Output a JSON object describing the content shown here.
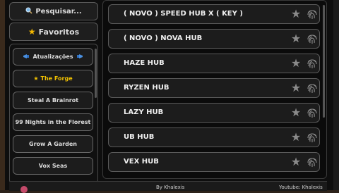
{
  "sidebar": {
    "search_label": "Pesquisar...",
    "favorites_label": "Favoritos",
    "categories": [
      {
        "label": "Atualizações",
        "active": false
      },
      {
        "label": "The Forge",
        "active": true
      },
      {
        "label": "Steal A Brainrot",
        "active": false
      },
      {
        "label": "99 Nights in the Florest",
        "active": false
      },
      {
        "label": "Grow A Garden",
        "active": false
      },
      {
        "label": "Vox Seas",
        "active": false
      }
    ]
  },
  "scripts": [
    {
      "name": "( NOVO ) SPEED HUB X ( KEY )"
    },
    {
      "name": "( NOVO ) NOVA HUB"
    },
    {
      "name": "HAZE HUB"
    },
    {
      "name": "RYZEN HUB"
    },
    {
      "name": "LAZY HUB"
    },
    {
      "name": "UB HUB"
    },
    {
      "name": "VEX HUB"
    }
  ],
  "footer": {
    "by_text": "By Khalexis",
    "youtube_text": "Youtube: Khalexis"
  },
  "icons": {
    "search": "magnifier-icon",
    "favorites": "star-icon",
    "updates": "megaphone-icon",
    "row_favorite": "star-icon",
    "row_action": "fingerprint-icon"
  },
  "colors": {
    "active_category": "#f2c200",
    "star_gray": "#8a8a8a",
    "favorites_star": "#f5b800"
  }
}
